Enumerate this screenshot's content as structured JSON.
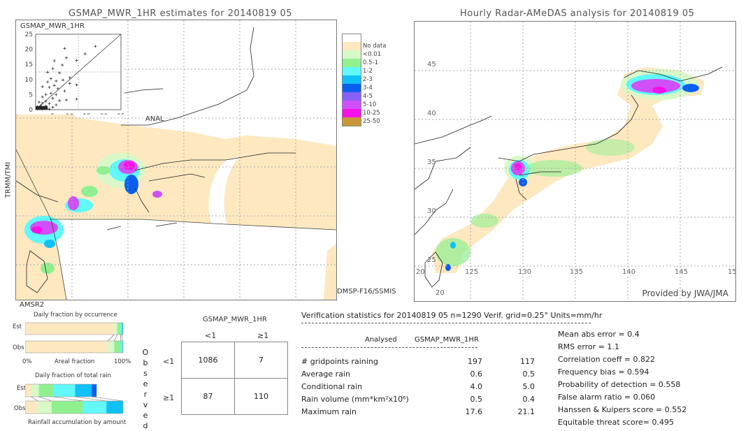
{
  "left_panel": {
    "title": "GSMAP_MWR_1HR estimates for 20140819 05",
    "scatter_title": "GSMAP_MWR_1HR",
    "scatter_xlabel": "ANAL",
    "scatter_ticks": [
      "0",
      "5",
      "10",
      "15",
      "20",
      "25"
    ],
    "sensor_labels": {
      "left": "TRMM/TMI",
      "bottom_left": "AMSR2",
      "bottom_right": "DMSP-F16/SSMIS"
    }
  },
  "right_panel": {
    "title": "Hourly Radar-AMeDAS analysis for 20140819 05",
    "lat_labels": [
      "45",
      "40",
      "35",
      "30",
      "25",
      "20"
    ],
    "lon_labels": [
      "20",
      "125",
      "130",
      "135",
      "140",
      "145",
      "15"
    ],
    "credit": "Provided by JWA/JMA"
  },
  "legend": {
    "items": [
      {
        "label": "",
        "color": "#ffffff"
      },
      {
        "label": "No data",
        "color": "#fde8c0"
      },
      {
        "label": "<0.01",
        "color": "#d8f8c8"
      },
      {
        "label": "0.5-1",
        "color": "#90f090"
      },
      {
        "label": "1-2",
        "color": "#60f8f8"
      },
      {
        "label": "2-3",
        "color": "#10c0f8"
      },
      {
        "label": "3-4",
        "color": "#0860f0"
      },
      {
        "label": "4-5",
        "color": "#8860f8"
      },
      {
        "label": "5-10",
        "color": "#d050f8"
      },
      {
        "label": "10-25",
        "color": "#f810e8"
      },
      {
        "label": "25-50",
        "color": "#c89838"
      }
    ]
  },
  "fraction_charts": {
    "occurrence_title": "Daily fraction by occurrence",
    "axis_left": "0%",
    "axis_mid": "Areal fraction",
    "axis_right": "100%",
    "est_label": "Est",
    "obs_label": "Obs",
    "total_title": "Daily fraction of total rain",
    "accum_title": "Rainfall accumulation by amount"
  },
  "contingency": {
    "title": "GSMAP_MWR_1HR",
    "col_headers": [
      "<1",
      "≥1"
    ],
    "row_headers": [
      "<1",
      "≥1"
    ],
    "side_label": "Observed",
    "cells": [
      [
        "1086",
        "7"
      ],
      [
        "87",
        "110"
      ]
    ]
  },
  "verification": {
    "header": "Verification statistics for 20140819 05   n=1290   Verif. grid=0.25°   Units=mm/hr",
    "col_analysed": "Analysed",
    "col_model": "GSMAP_MWR_1HR",
    "rows": [
      {
        "label": "# gridpoints raining",
        "analysed": "197",
        "model": "117"
      },
      {
        "label": "Average rain",
        "analysed": "0.6",
        "model": "0.5"
      },
      {
        "label": "Conditional rain",
        "analysed": "4.0",
        "model": "5.0"
      },
      {
        "label": "Rain volume (mm*km²x10⁶)",
        "analysed": "0.5",
        "model": "0.4"
      },
      {
        "label": "Maximum rain",
        "analysed": "17.6",
        "model": "21.1"
      }
    ],
    "scores": [
      "Mean abs error = 0.4",
      "RMS error = 1.1",
      "Correlation coeff = 0.822",
      "Frequency bias = 0.594",
      "Probability of detection = 0.558",
      "False alarm ratio = 0.060",
      "Hanssen & Kuipers score = 0.552",
      "Equitable threat score= 0.495"
    ]
  },
  "chart_data": [
    {
      "type": "scatter",
      "title": "GSMAP_MWR_1HR",
      "xlabel": "ANAL",
      "ylabel": "GSMAP_MWR_1HR",
      "xlim": [
        0,
        25
      ],
      "ylim": [
        0,
        25
      ],
      "x_ticks": [
        0,
        5,
        10,
        15,
        20,
        25
      ],
      "y_ticks": [
        0,
        5,
        10,
        15,
        20,
        25
      ],
      "reference_line": "y=x",
      "points": [
        [
          8.5,
          20.3
        ],
        [
          17.5,
          21
        ],
        [
          14.5,
          18.5
        ],
        [
          9,
          17.2
        ],
        [
          5.5,
          16.2
        ],
        [
          12,
          16.3
        ],
        [
          7.8,
          14.8
        ],
        [
          5,
          13.6
        ],
        [
          3.5,
          12.4
        ],
        [
          7,
          12.2
        ],
        [
          10,
          10.6
        ],
        [
          4.5,
          10.3
        ],
        [
          8,
          9.8
        ],
        [
          6,
          9.5
        ],
        [
          3.5,
          9.2
        ],
        [
          10,
          8.7
        ],
        [
          12,
          8.2
        ],
        [
          5.5,
          8
        ],
        [
          2,
          7.6
        ],
        [
          4,
          7.4
        ],
        [
          6.5,
          7
        ],
        [
          8.5,
          6.2
        ],
        [
          4.5,
          5.4
        ],
        [
          6,
          5
        ],
        [
          3,
          5
        ],
        [
          2,
          4.2
        ],
        [
          5,
          3.8
        ],
        [
          9,
          3.2
        ],
        [
          12,
          3.5
        ],
        [
          7,
          3
        ],
        [
          3,
          2.8
        ],
        [
          1,
          2.5
        ],
        [
          2,
          2.2
        ],
        [
          4,
          2
        ],
        [
          6,
          1.6
        ],
        [
          1.5,
          1.4
        ],
        [
          3,
          1.2
        ],
        [
          5,
          0.8
        ],
        [
          0.5,
          1
        ],
        [
          2.5,
          0.6
        ],
        [
          1,
          0.3
        ],
        [
          0.5,
          0.2
        ],
        [
          2,
          0.1
        ],
        [
          4,
          0.2
        ]
      ]
    },
    {
      "type": "bar",
      "title": "Daily fraction by occurrence",
      "xlabel": "Areal fraction",
      "xlim": [
        0,
        100
      ],
      "categories": [
        "Est",
        "Obs"
      ],
      "series_colors": [
        "#fde8c0",
        "#d8f8c8",
        "#90f090",
        "#60f8f8",
        "#10c0f8"
      ],
      "series": [
        {
          "name": "Est",
          "values": [
            91.0,
            3.0,
            3.5,
            1.5,
            1.0
          ]
        },
        {
          "name": "Obs",
          "values": [
            84.5,
            6.5,
            6.5,
            2.0,
            0.5
          ]
        }
      ]
    },
    {
      "type": "bar",
      "title": "Rainfall accumulation by amount",
      "subtitle": "Daily fraction of total rain",
      "categories": [
        "Est",
        "Obs"
      ],
      "series_colors": [
        "#fde8c0",
        "#d8f8c8",
        "#90f090",
        "#60f8f8",
        "#10c0f8",
        "#0860f0"
      ],
      "series": [
        {
          "name": "Est",
          "values": [
            6,
            8,
            15,
            22,
            17,
            5
          ]
        },
        {
          "name": "Obs",
          "values": [
            13,
            14,
            32,
            24,
            17,
            0
          ]
        }
      ]
    }
  ]
}
